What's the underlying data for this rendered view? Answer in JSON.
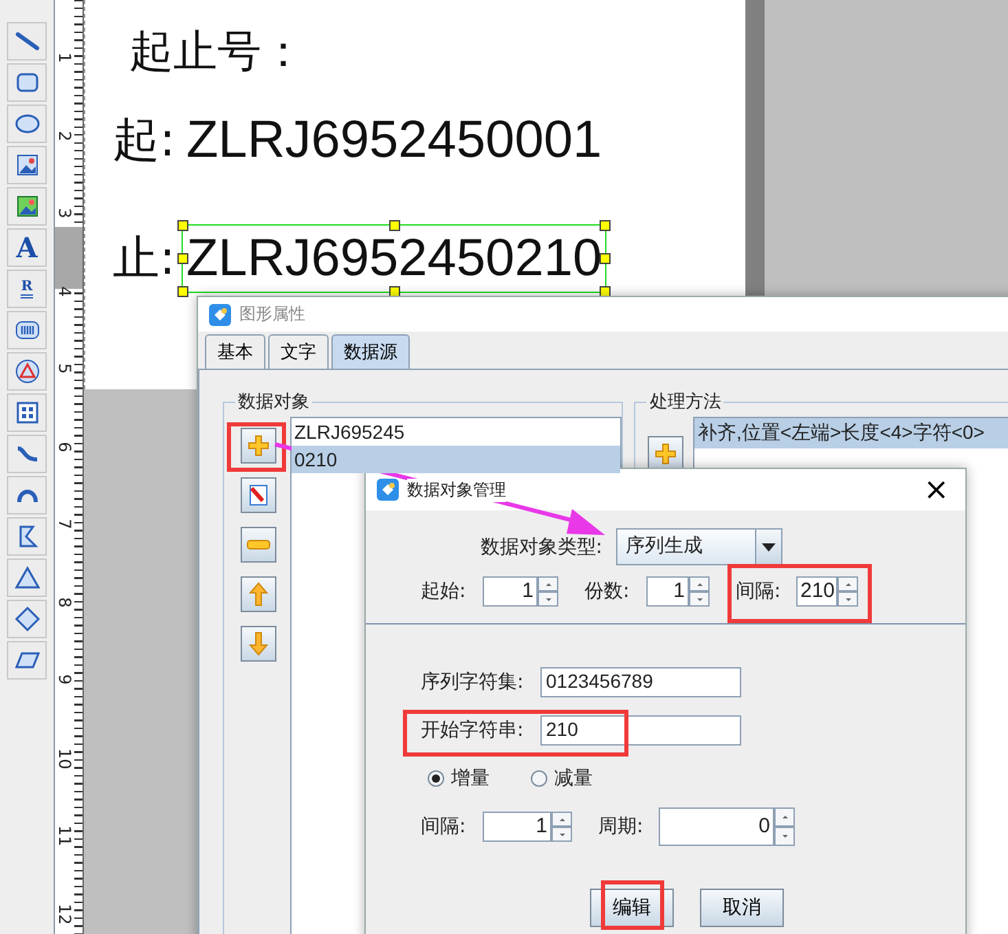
{
  "toolbar": {
    "text_tool_glyph": "A",
    "rich_text_glyph": "R"
  },
  "ruler": {
    "numbers": [
      "1",
      "2",
      "3",
      "4",
      "5",
      "6",
      "7",
      "8",
      "9",
      "10",
      "11",
      "12"
    ]
  },
  "canvas": {
    "heading": "起止号：",
    "lines": [
      {
        "label": "起:",
        "value": "ZLRJ6952450001",
        "selected": false
      },
      {
        "label": "止:",
        "value": "ZLRJ6952450210",
        "selected": true
      }
    ]
  },
  "properties_dialog": {
    "title": "图形属性",
    "tabs": [
      {
        "label": "基本",
        "selected": false
      },
      {
        "label": "文字",
        "selected": false
      },
      {
        "label": "数据源",
        "selected": true
      }
    ],
    "data_objects": {
      "title": "数据对象",
      "add_highlighted": true,
      "items": [
        {
          "text": "ZLRJ695245",
          "selected": false
        },
        {
          "text": "0210",
          "selected": true
        }
      ]
    },
    "processing": {
      "title": "处理方法",
      "items": [
        {
          "text": "补齐,位置<左端>长度<4>字符<0>",
          "selected": true
        }
      ]
    }
  },
  "data_object_dialog": {
    "title": "数据对象管理",
    "close": "×",
    "type_label": "数据对象类型:",
    "type_value": "序列生成",
    "start": {
      "label": "起始:",
      "value": "1",
      "highlighted": false
    },
    "copies": {
      "label": "份数:",
      "value": "1",
      "highlighted": false
    },
    "interval": {
      "label": "间隔:",
      "value": "210",
      "highlighted": true
    },
    "charset": {
      "label": "序列字符集:",
      "value": "0123456789",
      "highlighted": false
    },
    "start_string": {
      "label": "开始字符串:",
      "value": "210",
      "highlighted": true
    },
    "modes": [
      {
        "label": "增量",
        "selected": true
      },
      {
        "label": "减量",
        "selected": false
      }
    ],
    "step": {
      "label": "间隔:",
      "value": "1"
    },
    "period": {
      "label": "周期:",
      "value": "0"
    },
    "buttons": [
      {
        "label": "编辑",
        "highlighted": true
      },
      {
        "label": "取消",
        "highlighted": false
      }
    ]
  }
}
